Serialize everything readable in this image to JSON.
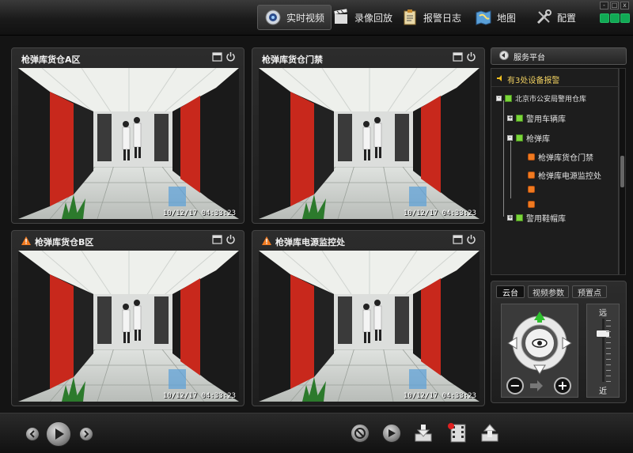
{
  "nav": {
    "items": [
      {
        "label": "实时视频",
        "icon": "camera-icon"
      },
      {
        "label": "录像回放",
        "icon": "film-icon"
      },
      {
        "label": "报警日志",
        "icon": "clipboard-icon"
      },
      {
        "label": "地图",
        "icon": "map-icon"
      },
      {
        "label": "配置",
        "icon": "tools-icon"
      }
    ]
  },
  "window": {
    "minimize": "-",
    "maximize": "□",
    "close": "x"
  },
  "videos": [
    {
      "title": "枪弹库货仓A区",
      "timestamp": "10/12/17 04:33:23",
      "alarm": false
    },
    {
      "title": "枪弹库货仓门禁",
      "timestamp": "10/12/17 04:33:23",
      "alarm": false
    },
    {
      "title": "枪弹库货仓B区",
      "timestamp": "10/12/17 04:33:23",
      "alarm": true
    },
    {
      "title": "枪弹库电源监控处",
      "timestamp": "10/12/17 04:33:23",
      "alarm": true
    }
  ],
  "server_button": "服务平台",
  "tree": {
    "alert": "有3处设备报警",
    "root": "北京市公安局警用仓库",
    "nodes": {
      "vehicle": "警用车辆库",
      "armory": "枪弹库",
      "gate": "枪弹库货仓门禁",
      "power": "枪弹库电源监控处",
      "shoes": "警用鞋帽库"
    }
  },
  "ptz": {
    "tabs": [
      "云台",
      "视频参数",
      "预置点"
    ],
    "zoom_far": "远",
    "zoom_near": "近"
  },
  "colors": {
    "accent_green": "#7ad63a",
    "alarm_orange": "#f07a20",
    "alarm_yellow": "#f0c020"
  }
}
